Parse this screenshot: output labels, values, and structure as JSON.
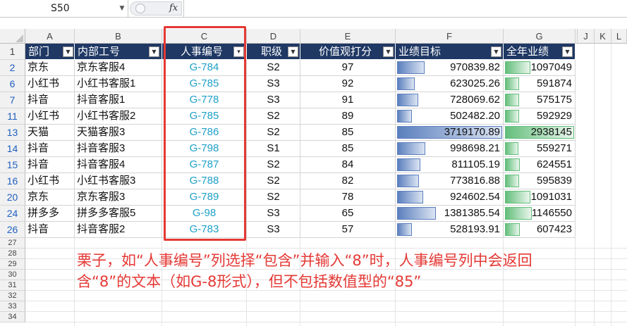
{
  "formula_bar": {
    "name_box": "S50",
    "fx": "fx",
    "formula": ""
  },
  "columns": [
    "A",
    "B",
    "C",
    "D",
    "E",
    "F",
    "G",
    "J",
    "K",
    "L"
  ],
  "table": {
    "headers": [
      "部门",
      "内部工号",
      "人事编号",
      "职级",
      "价值观打分",
      "业绩目标",
      "全年业绩"
    ],
    "filtered_column_icon": "filter-active-icon",
    "rows": [
      {
        "row": "2",
        "dept": "京东",
        "staff": "京东客服4",
        "code": "G-784",
        "level": "S2",
        "score": "97",
        "target": "970839.82",
        "annual": "1097049",
        "target_fill": 0.26,
        "annual_fill": 0.37
      },
      {
        "row": "6",
        "dept": "小红书",
        "staff": "小红书客服1",
        "code": "G-785",
        "level": "S3",
        "score": "92",
        "target": "623025.26",
        "annual": "591874",
        "target_fill": 0.17,
        "annual_fill": 0.2
      },
      {
        "row": "7",
        "dept": "抖音",
        "staff": "抖音客服1",
        "code": "G-778",
        "level": "S3",
        "score": "91",
        "target": "728069.62",
        "annual": "575175",
        "target_fill": 0.2,
        "annual_fill": 0.2
      },
      {
        "row": "11",
        "dept": "小红书",
        "staff": "小红书客服2",
        "code": "G-785",
        "level": "S2",
        "score": "89",
        "target": "502482.20",
        "annual": "592929",
        "target_fill": 0.14,
        "annual_fill": 0.2
      },
      {
        "row": "13",
        "dept": "天猫",
        "staff": "天猫客服3",
        "code": "G-786",
        "level": "S2",
        "score": "85",
        "target": "3719170.89",
        "annual": "2938145",
        "target_fill": 1.0,
        "annual_fill": 1.0
      },
      {
        "row": "14",
        "dept": "抖音",
        "staff": "抖音客服3",
        "code": "G-798",
        "level": "S1",
        "score": "85",
        "target": "998698.21",
        "annual": "559271",
        "target_fill": 0.27,
        "annual_fill": 0.19
      },
      {
        "row": "15",
        "dept": "抖音",
        "staff": "抖音客服4",
        "code": "G-787",
        "level": "S2",
        "score": "84",
        "target": "811105.19",
        "annual": "624551",
        "target_fill": 0.22,
        "annual_fill": 0.21
      },
      {
        "row": "16",
        "dept": "小红书",
        "staff": "小红书客服3",
        "code": "G-788",
        "level": "S2",
        "score": "82",
        "target": "773816.88",
        "annual": "595839",
        "target_fill": 0.21,
        "annual_fill": 0.2
      },
      {
        "row": "20",
        "dept": "京东",
        "staff": "京东客服3",
        "code": "G-789",
        "level": "S2",
        "score": "78",
        "target": "924602.54",
        "annual": "1091031",
        "target_fill": 0.25,
        "annual_fill": 0.37
      },
      {
        "row": "24",
        "dept": "拼多多",
        "staff": "拼多多客服5",
        "code": "G-98",
        "level": "S3",
        "score": "65",
        "target": "1381385.54",
        "annual": "1146550",
        "target_fill": 0.37,
        "annual_fill": 0.39
      },
      {
        "row": "26",
        "dept": "抖音",
        "staff": "抖音客服2",
        "code": "G-783",
        "level": "S3",
        "score": "57",
        "target": "528193.91",
        "annual": "607423",
        "target_fill": 0.14,
        "annual_fill": 0.21
      }
    ]
  },
  "empty_rows": [
    "27",
    "28",
    "29",
    "30",
    "31",
    "32",
    "33",
    "34"
  ],
  "annotation": "栗子，如“人事编号”列选择“包含”并输入“8”时，人事编号列中会返回含“8”的文本（如G-8形式），但不包括数值型的“85”",
  "colors": {
    "header_bg": "#1f3864",
    "code_text": "#1fa0c8",
    "annotation": "#e53935",
    "bar_blue": "#5b7fbd",
    "bar_green": "#63be7b"
  }
}
